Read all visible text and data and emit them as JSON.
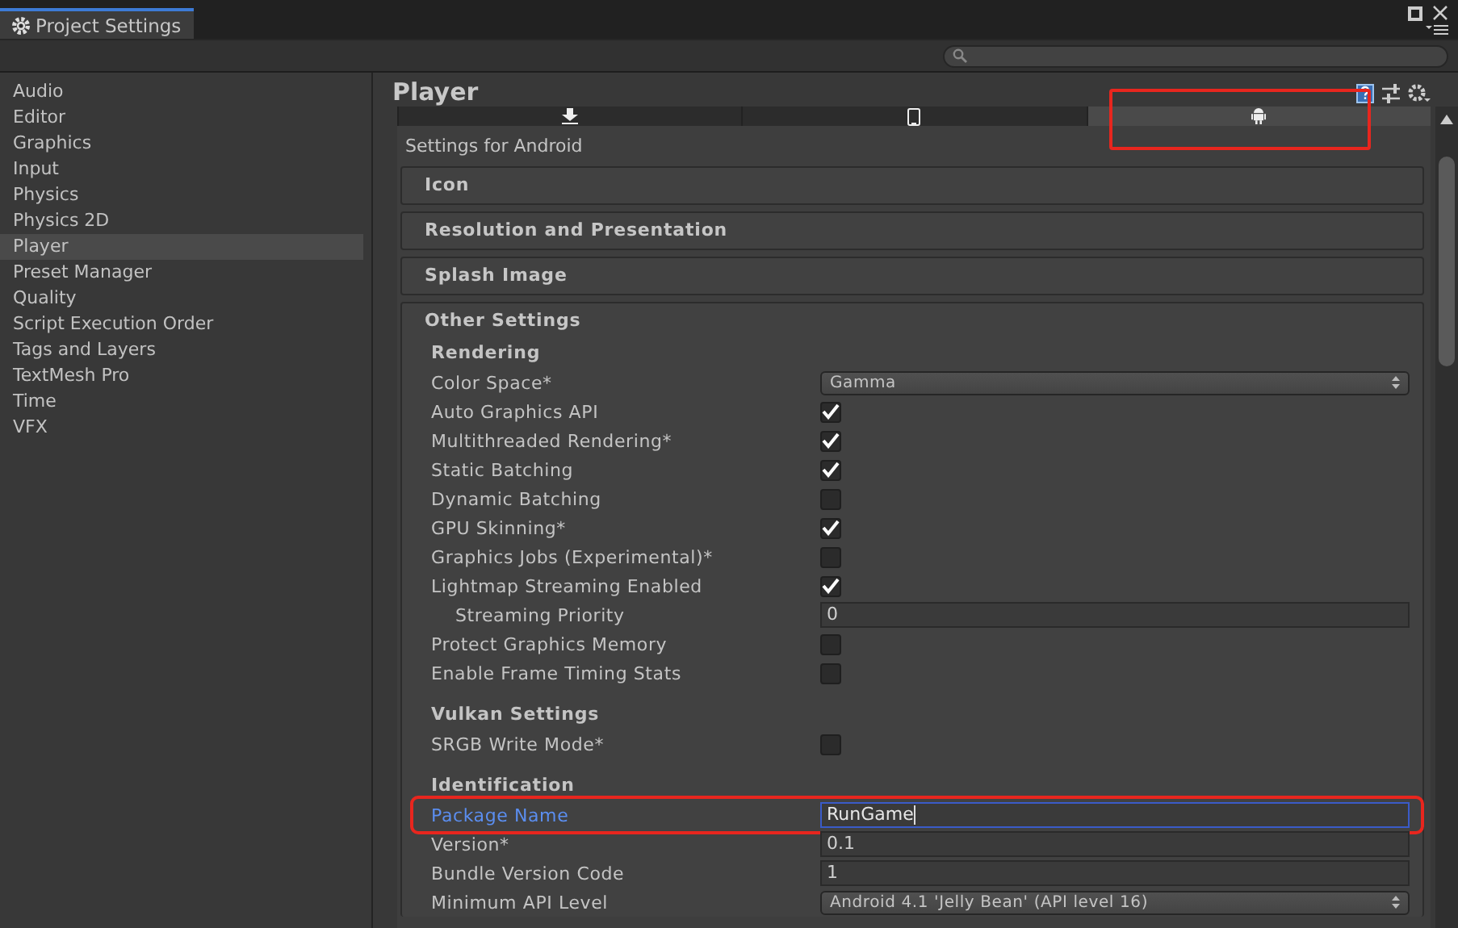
{
  "window": {
    "tab_title": "Project Settings"
  },
  "sidebar": {
    "items": [
      {
        "label": "Audio",
        "selected": false
      },
      {
        "label": "Editor",
        "selected": false
      },
      {
        "label": "Graphics",
        "selected": false
      },
      {
        "label": "Input",
        "selected": false
      },
      {
        "label": "Physics",
        "selected": false
      },
      {
        "label": "Physics 2D",
        "selected": false
      },
      {
        "label": "Player",
        "selected": true
      },
      {
        "label": "Preset Manager",
        "selected": false
      },
      {
        "label": "Quality",
        "selected": false
      },
      {
        "label": "Script Execution Order",
        "selected": false
      },
      {
        "label": "Tags and Layers",
        "selected": false
      },
      {
        "label": "TextMesh Pro",
        "selected": false
      },
      {
        "label": "Time",
        "selected": false
      },
      {
        "label": "VFX",
        "selected": false
      }
    ]
  },
  "inspector": {
    "title": "Player",
    "platform_tabs": [
      {
        "kind": "download",
        "selected": false,
        "highlighted": false
      },
      {
        "kind": "phone",
        "selected": false,
        "highlighted": false
      },
      {
        "kind": "android",
        "selected": true,
        "highlighted": true
      }
    ],
    "subtitle": "Settings for Android",
    "sections": [
      {
        "title": "Icon",
        "expanded": false
      },
      {
        "title": "Resolution and Presentation",
        "expanded": false
      },
      {
        "title": "Splash Image",
        "expanded": false
      },
      {
        "title": "Other Settings",
        "expanded": true
      }
    ],
    "groups": [
      {
        "title": "Rendering",
        "rows": [
          {
            "kind": "dropdown",
            "label": "Color Space*",
            "value": "Gamma"
          },
          {
            "kind": "checkbox",
            "label": "Auto Graphics API",
            "checked": true
          },
          {
            "kind": "checkbox",
            "label": "Multithreaded Rendering*",
            "checked": true
          },
          {
            "kind": "checkbox",
            "label": "Static Batching",
            "checked": true
          },
          {
            "kind": "checkbox",
            "label": "Dynamic Batching",
            "checked": false
          },
          {
            "kind": "checkbox",
            "label": "GPU Skinning*",
            "checked": true
          },
          {
            "kind": "checkbox",
            "label": "Graphics Jobs (Experimental)*",
            "checked": false
          },
          {
            "kind": "checkbox",
            "label": "Lightmap Streaming Enabled",
            "checked": true
          },
          {
            "kind": "text",
            "label": "Streaming Priority",
            "value": "0",
            "indented": true
          },
          {
            "kind": "checkbox",
            "label": "Protect Graphics Memory",
            "checked": false
          },
          {
            "kind": "checkbox",
            "label": "Enable Frame Timing Stats",
            "checked": false
          }
        ]
      },
      {
        "title": "Vulkan Settings",
        "rows": [
          {
            "kind": "checkbox",
            "label": "SRGB Write Mode*",
            "checked": false
          }
        ]
      },
      {
        "title": "Identification",
        "rows": [
          {
            "kind": "text",
            "label": "Package Name",
            "value": "RunGame",
            "focused": true,
            "highlighted": true
          },
          {
            "kind": "text",
            "label": "Version*",
            "value": "0.1"
          },
          {
            "kind": "text",
            "label": "Bundle Version Code",
            "value": "1"
          },
          {
            "kind": "dropdown",
            "label": "Minimum API Level",
            "value": "Android 4.1 'Jelly Bean' (API level 16)"
          }
        ]
      }
    ]
  }
}
